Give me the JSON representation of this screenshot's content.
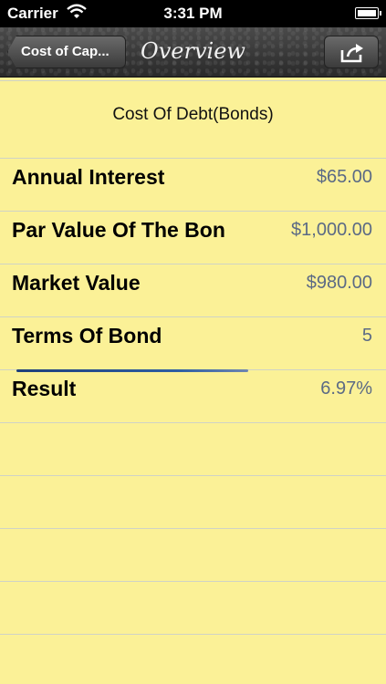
{
  "status": {
    "carrier": "Carrier",
    "time": "3:31 PM"
  },
  "nav": {
    "back_label": "Cost of Cap...",
    "title": "Overview"
  },
  "section": {
    "header": "Cost Of Debt(Bonds)"
  },
  "rows": [
    {
      "label": "Annual Interest",
      "value": "$65.00"
    },
    {
      "label": "Par Value Of The Bon",
      "value": "$1,000.00"
    },
    {
      "label": "Market Value",
      "value": "$980.00"
    },
    {
      "label": "Terms Of Bond",
      "value": "5"
    },
    {
      "label": "Result",
      "value": "6.97%"
    }
  ],
  "icons": {
    "wifi": "wifi-icon",
    "battery": "battery-icon",
    "share": "share-icon"
  }
}
